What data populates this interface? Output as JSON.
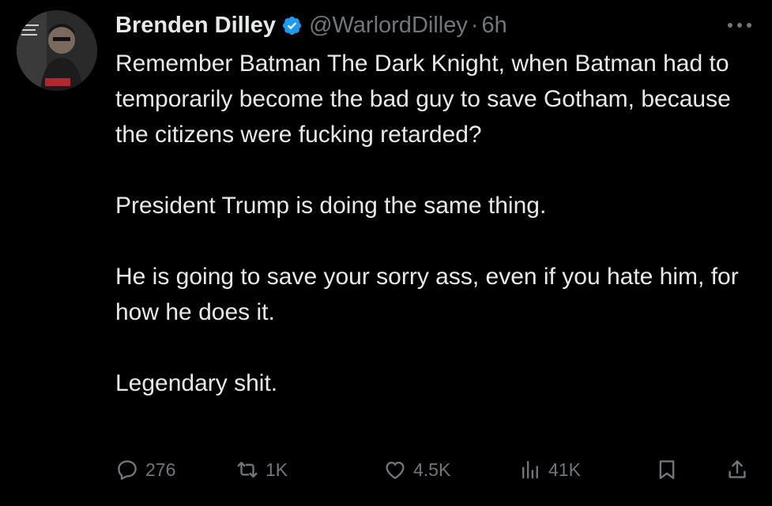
{
  "tweet": {
    "display_name": "Brenden Dilley",
    "handle": "@WarlordDilley",
    "separator": "·",
    "time": "6h",
    "body_paragraphs": [
      "Remember Batman The Dark Knight, when Batman had to temporarily become the bad guy to save Gotham, because the citizens were fucking retarded?",
      "President Trump is doing the same thing.",
      "He is going to save your sorry ass, even if you hate him, for how he does it.",
      "Legendary shit."
    ]
  },
  "actions": {
    "replies": "276",
    "reposts": "1K",
    "likes": "4.5K",
    "views": "41K"
  },
  "colors": {
    "background": "#000000",
    "text": "#e7e9ea",
    "muted": "#71767b",
    "verified": "#1d9bf0"
  },
  "icons": [
    "verified-badge-icon",
    "more-icon",
    "reply-icon",
    "repost-icon",
    "like-icon",
    "views-icon",
    "bookmark-icon",
    "share-icon"
  ]
}
